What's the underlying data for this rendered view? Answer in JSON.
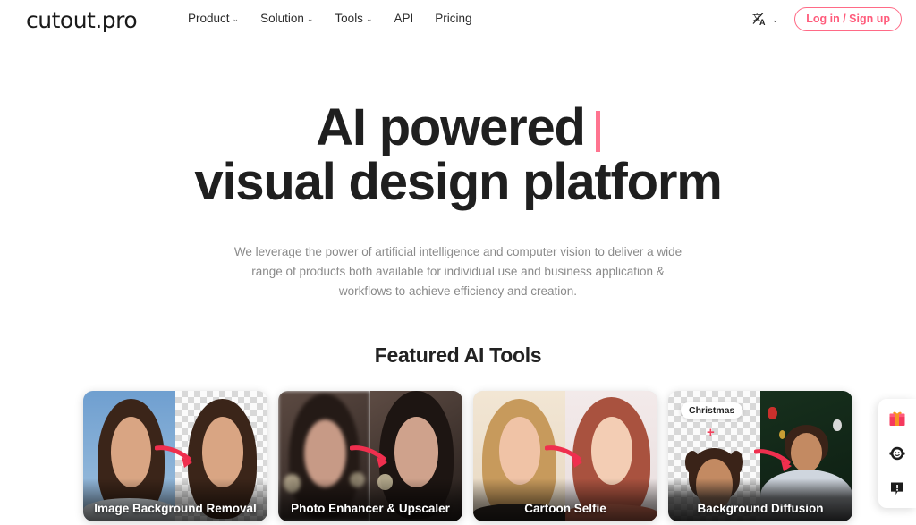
{
  "brand": {
    "logo_text": "cutout.pro",
    "accent_pink": "#ff5b7b",
    "accent_caret": "#ff7490"
  },
  "header": {
    "nav": [
      {
        "label": "Product",
        "has_dropdown": true,
        "chevron": "⌄"
      },
      {
        "label": "Solution",
        "has_dropdown": true,
        "chevron": "⌄"
      },
      {
        "label": "Tools",
        "has_dropdown": true,
        "chevron": "⌄"
      },
      {
        "label": "API",
        "has_dropdown": false,
        "chevron": ""
      },
      {
        "label": "Pricing",
        "has_dropdown": false,
        "chevron": ""
      }
    ],
    "language": {
      "icon": "translate-icon",
      "glyph": "文A",
      "chevron": "⌄"
    },
    "login_button": "Log in / Sign up"
  },
  "hero": {
    "headline_line1": "AI powered",
    "headline_line2": "visual design platform",
    "caret_visible": true,
    "subtitle": "We leverage the power of artificial intelligence and computer vision to deliver a wide range of products both available for individual use and business application & workflows to achieve efficiency and creation."
  },
  "featured": {
    "title": "Featured AI Tools",
    "cards": [
      {
        "label": "Image Background Removal",
        "layout": "before-after",
        "after_transparent": true,
        "arrow": "pink-arrow-icon"
      },
      {
        "label": "Photo Enhancer & Upscaler",
        "layout": "before-after",
        "after_transparent": false,
        "arrow": "pink-arrow-icon"
      },
      {
        "label": "Cartoon Selfie",
        "layout": "before-after",
        "after_transparent": false,
        "arrow": "pink-arrow-icon"
      },
      {
        "label": "Background Diffusion",
        "layout": "before-after",
        "after_transparent": false,
        "arrow": "pink-arrow-icon",
        "badge": "Christmas",
        "plus": "+"
      }
    ]
  },
  "widget": {
    "buttons": [
      {
        "name": "gift-icon",
        "title": "Gift"
      },
      {
        "name": "support-chat-icon",
        "title": "Support"
      },
      {
        "name": "feedback-icon",
        "title": "Feedback"
      }
    ]
  }
}
